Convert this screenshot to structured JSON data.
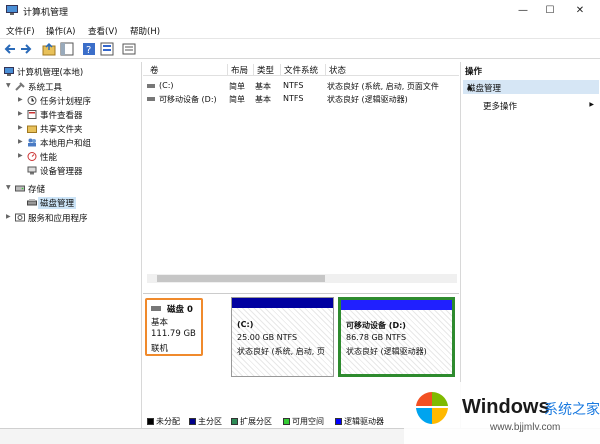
{
  "window": {
    "title": "计算机管理",
    "minimize_glyph": "—",
    "maximize_glyph": "☐",
    "close_glyph": "✕"
  },
  "menu": [
    "文件(F)",
    "操作(A)",
    "查看(V)",
    "帮助(H)"
  ],
  "tree": {
    "root": "计算机管理(本地)",
    "system_tools": "系统工具",
    "items": [
      "任务计划程序",
      "事件查看器",
      "共享文件夹",
      "本地用户和组",
      "性能",
      "设备管理器"
    ],
    "storage": "存储",
    "disk_management": "磁盘管理",
    "services": "服务和应用程序"
  },
  "volume_table": {
    "headers": [
      "卷",
      "布局",
      "类型",
      "文件系统",
      "状态"
    ],
    "rows": [
      [
        "(C:)",
        "简单",
        "基本",
        "NTFS",
        "状态良好 (系统, 启动, 页面文件"
      ],
      [
        "可移动设备 (D:)",
        "简单",
        "基本",
        "NTFS",
        "状态良好 (逻辑驱动器)"
      ]
    ]
  },
  "disk": {
    "name": "磁盘 0",
    "type": "基本",
    "size": "111.79 GB",
    "state": "联机",
    "partitions": [
      {
        "label": "(C:)",
        "size": "25.00 GB NTFS",
        "status": "状态良好 (系统, 启动, 页",
        "bar_color": "#0000a0"
      },
      {
        "label": "可移动设备 (D:)",
        "size": "86.78 GB NTFS",
        "status": "状态良好 (逻辑驱动器)",
        "bar_color": "#2020ff"
      }
    ]
  },
  "legend": [
    {
      "label": "未分配",
      "color": "#000000"
    },
    {
      "label": "主分区",
      "color": "#00008b"
    },
    {
      "label": "扩展分区",
      "color": "#2e8b57"
    },
    {
      "label": "可用空间",
      "color": "#33cc33"
    },
    {
      "label": "逻辑驱动器",
      "color": "#0000ff"
    }
  ],
  "actions": {
    "title": "操作",
    "group": "磁盘管理",
    "more": "更多操作"
  },
  "watermark": {
    "brand": "Windows",
    "cn": "系统之家",
    "url": "www.bjjmlv.com"
  },
  "colors": {
    "selection_border": "#f08a2c",
    "partition_selected_border": "#2e8b2e",
    "action_group_bg": "#d6e6f5"
  }
}
